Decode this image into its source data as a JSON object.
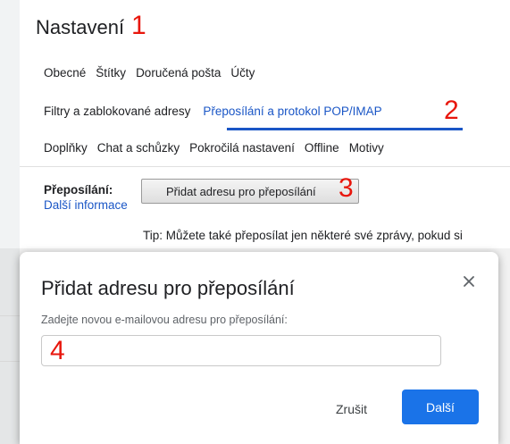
{
  "page": {
    "title": "Nastavení"
  },
  "annotations": {
    "a1": "1",
    "a2": "2",
    "a3": "3",
    "a4": "4"
  },
  "tabs": {
    "row1": [
      "Obecné",
      "Štítky",
      "Doručená pošta",
      "Účty"
    ],
    "row2": [
      "Filtry a zablokované adresy",
      "Přeposílání a protokol POP/IMAP"
    ],
    "row3": [
      "Doplňky",
      "Chat a schůzky",
      "Pokročilá nastavení",
      "Offline",
      "Motivy"
    ],
    "active": "Přeposílání a protokol POP/IMAP"
  },
  "forwarding": {
    "label": "Přeposílání:",
    "more_info": "Další informace",
    "add_button": "Přidat adresu pro přeposílání",
    "tip": "Tip: Můžete také přeposílat jen některé své zprávy, pokud si"
  },
  "dialog": {
    "title": "Přidat adresu pro přeposílání",
    "close_icon": "close-icon",
    "field_label": "Zadejte novou e-mailovou adresu pro přeposílání:",
    "field_value": "",
    "cancel": "Zrušit",
    "next": "Další"
  },
  "colors": {
    "accent": "#1a73e8",
    "link": "#1a56c6",
    "annotation": "#e8160c"
  }
}
